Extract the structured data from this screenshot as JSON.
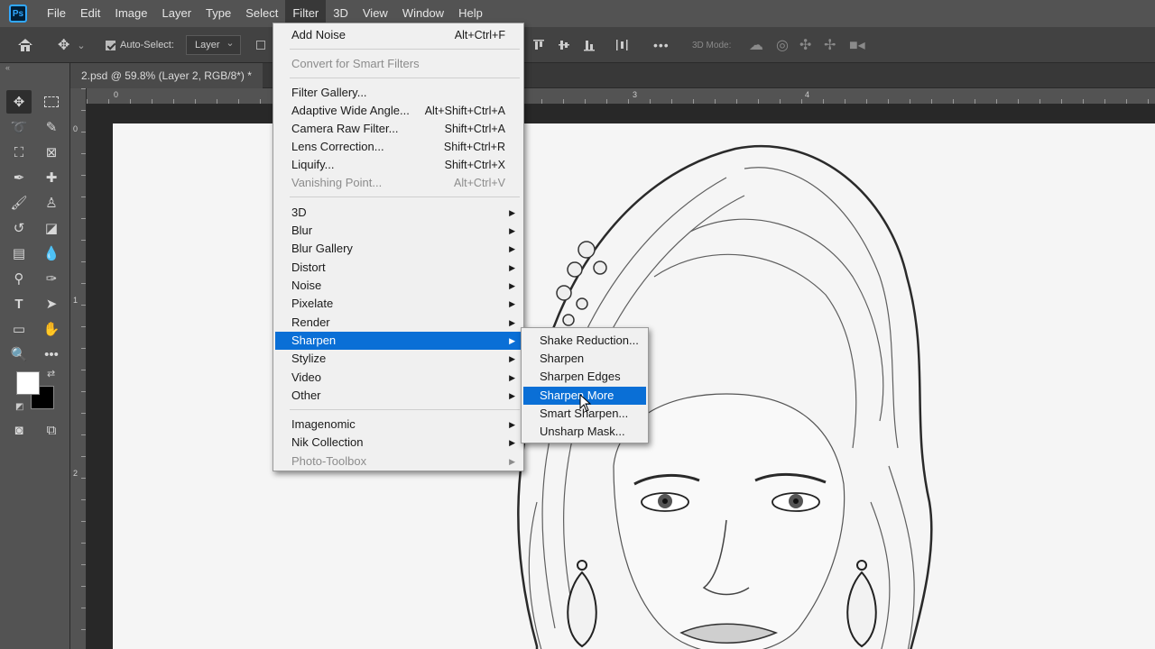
{
  "app": {
    "logo": "Ps"
  },
  "menubar": [
    "File",
    "Edit",
    "Image",
    "Layer",
    "Type",
    "Select",
    "Filter",
    "3D",
    "View",
    "Window",
    "Help"
  ],
  "options": {
    "auto_select_label": "Auto-Select:",
    "auto_select_value": "Layer",
    "mode_3d": "3D Mode:"
  },
  "document": {
    "tab_title": "2.psd @ 59.8% (Layer 2, RGB/8*) *"
  },
  "ruler": {
    "top": [
      "0",
      "3",
      "4"
    ],
    "left": [
      "0",
      "1",
      "2"
    ]
  },
  "filter_menu": {
    "items": [
      {
        "label": "Add Noise",
        "shortcut": "Alt+Ctrl+F"
      },
      {
        "label": "Convert for Smart Filters",
        "disabled": true
      },
      {
        "label": "Filter Gallery..."
      },
      {
        "label": "Adaptive Wide Angle...",
        "shortcut": "Alt+Shift+Ctrl+A"
      },
      {
        "label": "Camera Raw Filter...",
        "shortcut": "Shift+Ctrl+A"
      },
      {
        "label": "Lens Correction...",
        "shortcut": "Shift+Ctrl+R"
      },
      {
        "label": "Liquify...",
        "shortcut": "Shift+Ctrl+X"
      },
      {
        "label": "Vanishing Point...",
        "shortcut": "Alt+Ctrl+V",
        "disabled": true
      },
      {
        "label": "3D"
      },
      {
        "label": "Blur"
      },
      {
        "label": "Blur Gallery"
      },
      {
        "label": "Distort"
      },
      {
        "label": "Noise"
      },
      {
        "label": "Pixelate"
      },
      {
        "label": "Render"
      },
      {
        "label": "Sharpen",
        "highlighted": true
      },
      {
        "label": "Stylize"
      },
      {
        "label": "Video"
      },
      {
        "label": "Other"
      },
      {
        "label": "Imagenomic"
      },
      {
        "label": "Nik Collection"
      },
      {
        "label": "Photo-Toolbox",
        "disabled": true
      }
    ]
  },
  "sharpen_submenu": {
    "items": [
      {
        "label": "Shake Reduction..."
      },
      {
        "label": "Sharpen"
      },
      {
        "label": "Sharpen Edges"
      },
      {
        "label": "Sharpen More",
        "highlighted": true
      },
      {
        "label": "Smart Sharpen..."
      },
      {
        "label": "Unsharp Mask..."
      }
    ]
  },
  "colors": {
    "highlight": "#0a6fd6",
    "foreground": "#ffffff",
    "background": "#000000"
  }
}
